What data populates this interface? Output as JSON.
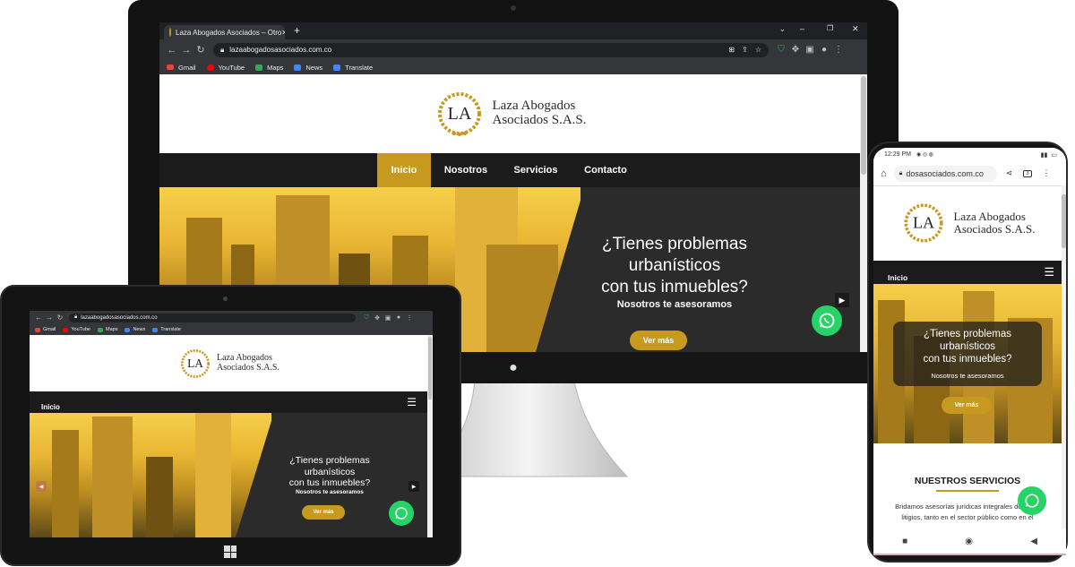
{
  "desktop": {
    "tab_title": "Laza Abogados Asociados – Otro",
    "new_tab_icon": "plus-icon",
    "url": "lazaabogadosasociados.com.co",
    "bookmarks": [
      {
        "label": "Gmail",
        "icon": "gmail-icon",
        "color": "#ea4335"
      },
      {
        "label": "YouTube",
        "icon": "youtube-icon",
        "color": "#ff0000"
      },
      {
        "label": "Maps",
        "icon": "maps-icon",
        "color": "#34a853"
      },
      {
        "label": "News",
        "icon": "news-icon",
        "color": "#4285f4"
      },
      {
        "label": "Translate",
        "icon": "translate-icon",
        "color": "#4285f4"
      }
    ],
    "logo_line1": "Laza Abogados",
    "logo_line2": "Asociados S.A.S.",
    "nav": [
      {
        "label": "Inicio",
        "active": true
      },
      {
        "label": "Nosotros",
        "active": false
      },
      {
        "label": "Servicios",
        "active": false
      },
      {
        "label": "Contacto",
        "active": false
      }
    ],
    "hero_line1": "¿Tienes problemas",
    "hero_line2": "urbanísticos",
    "hero_line3": "con tus inmuebles?",
    "hero_sub": "Nosotros te asesoramos",
    "hero_button": "Ver más"
  },
  "tablet": {
    "url": "lazaabogadosasociados.com.co",
    "bookmarks": [
      "Gmail",
      "YouTube",
      "Maps",
      "News",
      "Translate"
    ],
    "logo_line1": "Laza Abogados",
    "logo_line2": "Asociados S.A.S.",
    "menu_label": "Inicio",
    "hero_line1": "¿Tienes problemas",
    "hero_line2": "urbanísticos",
    "hero_line3": "con tus inmuebles?",
    "hero_sub": "Nosotros te asesoramos",
    "hero_button": "Ver más"
  },
  "phone": {
    "status_time": "12:29 PM",
    "url": "dosasociados.com.co",
    "logo_line1": "Laza Abogados",
    "logo_line2": "Asociados S.A.S.",
    "menu_label": "Inicio",
    "hero_line1": "¿Tienes problemas",
    "hero_line2": "urbanísticos",
    "hero_line3": "con tus inmuebles?",
    "hero_sub": "Nosotros te asesoramos",
    "hero_button": "Ver más",
    "section_title": "NUESTROS SERVICIOS",
    "section_line1": "Bridamos asesorías jurídicas integrales de ... as,",
    "section_line2": "litigios, tanto en el sector público como en el"
  },
  "colors": {
    "gold": "#c8991f",
    "nav_dark": "#1b1b1b",
    "whatsapp": "#25d366"
  }
}
